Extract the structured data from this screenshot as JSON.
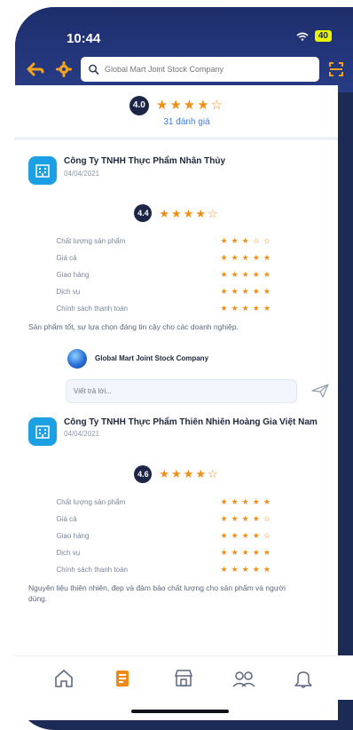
{
  "status": {
    "time": "10:44",
    "battery": "40"
  },
  "header": {
    "search": {
      "value": "",
      "placeholder": "Global Mart Joint Stock Company"
    }
  },
  "summary": {
    "score": "4.0",
    "count": "31 đánh giá"
  },
  "reviews": [
    {
      "company": "Công Ty TNHH Thực Phẩm Nhân Thủy",
      "date": "04/04/2021",
      "score": "4.4",
      "criteria": [
        {
          "label": "Chất lượng sản phẩm",
          "filled": 3
        },
        {
          "label": "Giá cả",
          "filled": 5
        },
        {
          "label": "Giao hàng",
          "filled": 5
        },
        {
          "label": "Dịch vụ",
          "filled": 5
        },
        {
          "label": "Chính sách thanh toán",
          "filled": 5
        }
      ],
      "text": "Sản phẩm tốt, sự lựa chọn đáng tin cậy cho các doanh nghiệp."
    },
    {
      "company": "Công Ty TNHH Thực Phẩm Thiên Nhiên Hoàng Gia Việt Nam",
      "date": "04/04/2021",
      "score": "4.6",
      "criteria": [
        {
          "label": "Chất lượng sản phẩm",
          "filled": 5
        },
        {
          "label": "Giá cả",
          "filled": 4
        },
        {
          "label": "Giao hàng",
          "filled": 4
        },
        {
          "label": "Dịch vụ",
          "filled": 5
        },
        {
          "label": "Chính sách thanh toán",
          "filled": 5
        }
      ],
      "text": "Nguyên liệu thiên nhiên, đẹp và đảm bảo chất lượng cho sản phẩm và người dùng."
    }
  ],
  "reply": {
    "company": "Global Mart Joint Stock Company",
    "input": {
      "value": "",
      "placeholder": "Viết trả lời..."
    }
  },
  "nav": {
    "items": [
      {
        "icon": "home-icon"
      },
      {
        "icon": "document-icon"
      },
      {
        "icon": "store-icon"
      },
      {
        "icon": "users-icon"
      },
      {
        "icon": "notification-icon"
      }
    ]
  },
  "colors": {
    "accent": "#ef8f1b",
    "brand": "#1c2b55",
    "link": "#3f7ee8"
  }
}
